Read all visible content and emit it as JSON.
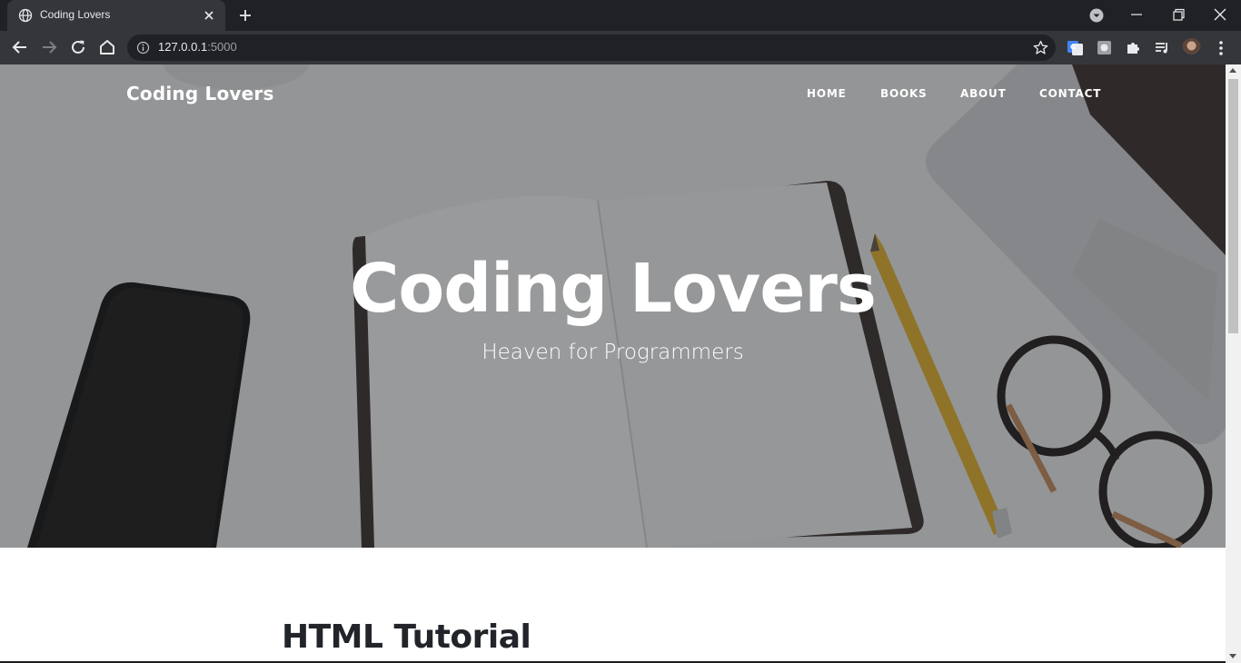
{
  "browser": {
    "tab": {
      "title": "Coding Lovers",
      "favicon": "globe-icon",
      "close_icon": "close-icon"
    },
    "new_tab_icon": "plus-icon",
    "omnibox": {
      "url_host": "127.0.0.1",
      "url_port": ":5000",
      "info_icon": "info-icon",
      "bookmark_icon": "star-icon"
    },
    "extensions": [
      "google-translate-icon",
      "extension-icon",
      "puzzle-icon",
      "media-controls-icon"
    ],
    "window_controls": [
      "minimize-icon",
      "restore-icon",
      "close-icon"
    ]
  },
  "site": {
    "brand": "Coding Lovers",
    "nav": [
      "HOME",
      "BOOKS",
      "ABOUT",
      "CONTACT"
    ],
    "hero": {
      "title": "Coding Lovers",
      "subtitle": "Heaven for Programmers"
    },
    "section_heading": "HTML Tutorial"
  },
  "colors": {
    "chrome_dark": "#202124",
    "chrome_toolbar": "#35363a",
    "heading_text": "#212529",
    "pencil": "#e7b32b"
  }
}
